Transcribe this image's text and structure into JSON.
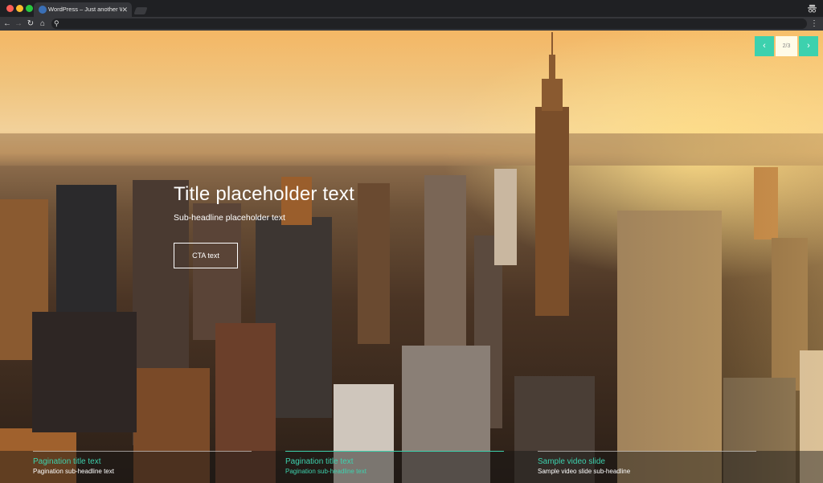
{
  "browser": {
    "tab_title": "WordPress – Just another Wor",
    "close_glyph": "✕",
    "back_glyph": "←",
    "forward_glyph": "→",
    "reload_glyph": "↻",
    "home_glyph": "⌂",
    "search_glyph": "⚲",
    "menu_glyph": "⋮",
    "url": ""
  },
  "slider": {
    "title": "Title placeholder text",
    "subtitle": "Sub-headline placeholder text",
    "cta_label": "CTA text",
    "counter": "2/3",
    "prev_glyph": "‹",
    "next_glyph": "›",
    "accent_color": "#3dd1ae",
    "pagination": [
      {
        "title": "Pagination title text",
        "subtitle": "Pagination sub-headline text"
      },
      {
        "title": "Pagination title text",
        "subtitle": "Pagination sub-headline text"
      },
      {
        "title": "Sample video slide",
        "subtitle": "Sample video slide sub-headline"
      }
    ]
  }
}
